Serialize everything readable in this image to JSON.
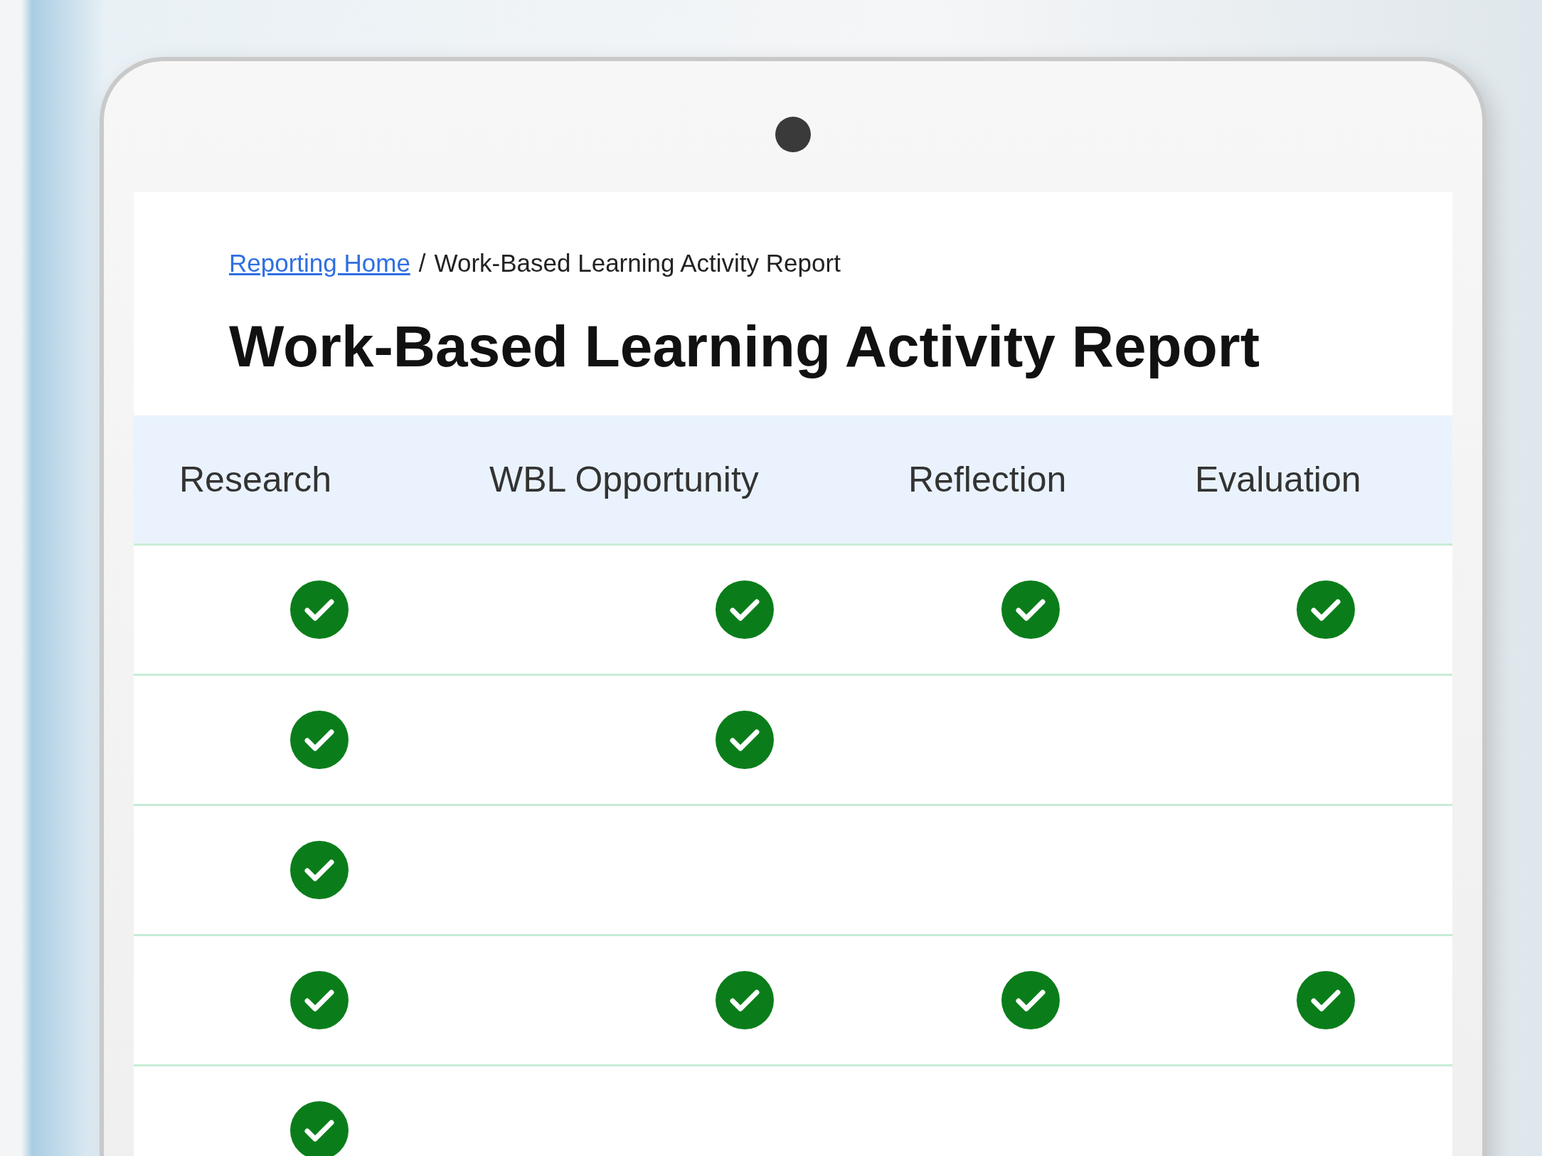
{
  "breadcrumb": {
    "link": "Reporting Home",
    "separator": "/",
    "current": "Work-Based Learning Activity Report"
  },
  "title": "Work-Based Learning Activity Report",
  "table": {
    "columns": [
      "Research",
      "WBL Opportunity",
      "Reflection",
      "Evaluation"
    ],
    "rows": [
      {
        "cells": [
          {
            "checked": true
          },
          {
            "checked": true
          },
          {
            "checked": true
          },
          {
            "checked": true
          }
        ]
      },
      {
        "cells": [
          {
            "checked": true
          },
          {
            "checked": true
          },
          {
            "checked": false
          },
          {
            "checked": false
          }
        ]
      },
      {
        "cells": [
          {
            "checked": true
          },
          {
            "checked": false
          },
          {
            "checked": false
          },
          {
            "checked": false
          }
        ]
      },
      {
        "cells": [
          {
            "checked": true
          },
          {
            "checked": true
          },
          {
            "checked": true
          },
          {
            "checked": true
          }
        ]
      },
      {
        "cells": [
          {
            "checked": true
          }
        ]
      }
    ]
  }
}
